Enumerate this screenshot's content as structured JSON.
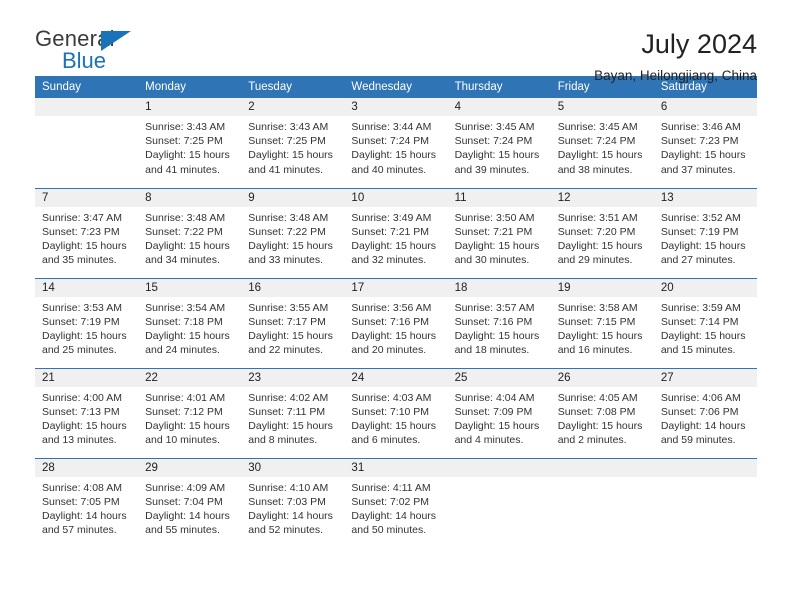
{
  "brand": {
    "name_top": "General",
    "name_bottom": "Blue"
  },
  "header": {
    "title": "July 2024",
    "subtitle": "Bayan, Heilongjiang, China"
  },
  "calendar": {
    "weekday_headers": [
      "Sunday",
      "Monday",
      "Tuesday",
      "Wednesday",
      "Thursday",
      "Friday",
      "Saturday"
    ],
    "accent_color": "#2f74b5",
    "daynum_background": "#f0f0f0",
    "weeks": [
      [
        {
          "day": "",
          "sunrise": "",
          "sunset": "",
          "daylight1": "",
          "daylight2": ""
        },
        {
          "day": "1",
          "sunrise": "Sunrise: 3:43 AM",
          "sunset": "Sunset: 7:25 PM",
          "daylight1": "Daylight: 15 hours",
          "daylight2": "and 41 minutes."
        },
        {
          "day": "2",
          "sunrise": "Sunrise: 3:43 AM",
          "sunset": "Sunset: 7:25 PM",
          "daylight1": "Daylight: 15 hours",
          "daylight2": "and 41 minutes."
        },
        {
          "day": "3",
          "sunrise": "Sunrise: 3:44 AM",
          "sunset": "Sunset: 7:24 PM",
          "daylight1": "Daylight: 15 hours",
          "daylight2": "and 40 minutes."
        },
        {
          "day": "4",
          "sunrise": "Sunrise: 3:45 AM",
          "sunset": "Sunset: 7:24 PM",
          "daylight1": "Daylight: 15 hours",
          "daylight2": "and 39 minutes."
        },
        {
          "day": "5",
          "sunrise": "Sunrise: 3:45 AM",
          "sunset": "Sunset: 7:24 PM",
          "daylight1": "Daylight: 15 hours",
          "daylight2": "and 38 minutes."
        },
        {
          "day": "6",
          "sunrise": "Sunrise: 3:46 AM",
          "sunset": "Sunset: 7:23 PM",
          "daylight1": "Daylight: 15 hours",
          "daylight2": "and 37 minutes."
        }
      ],
      [
        {
          "day": "7",
          "sunrise": "Sunrise: 3:47 AM",
          "sunset": "Sunset: 7:23 PM",
          "daylight1": "Daylight: 15 hours",
          "daylight2": "and 35 minutes."
        },
        {
          "day": "8",
          "sunrise": "Sunrise: 3:48 AM",
          "sunset": "Sunset: 7:22 PM",
          "daylight1": "Daylight: 15 hours",
          "daylight2": "and 34 minutes."
        },
        {
          "day": "9",
          "sunrise": "Sunrise: 3:48 AM",
          "sunset": "Sunset: 7:22 PM",
          "daylight1": "Daylight: 15 hours",
          "daylight2": "and 33 minutes."
        },
        {
          "day": "10",
          "sunrise": "Sunrise: 3:49 AM",
          "sunset": "Sunset: 7:21 PM",
          "daylight1": "Daylight: 15 hours",
          "daylight2": "and 32 minutes."
        },
        {
          "day": "11",
          "sunrise": "Sunrise: 3:50 AM",
          "sunset": "Sunset: 7:21 PM",
          "daylight1": "Daylight: 15 hours",
          "daylight2": "and 30 minutes."
        },
        {
          "day": "12",
          "sunrise": "Sunrise: 3:51 AM",
          "sunset": "Sunset: 7:20 PM",
          "daylight1": "Daylight: 15 hours",
          "daylight2": "and 29 minutes."
        },
        {
          "day": "13",
          "sunrise": "Sunrise: 3:52 AM",
          "sunset": "Sunset: 7:19 PM",
          "daylight1": "Daylight: 15 hours",
          "daylight2": "and 27 minutes."
        }
      ],
      [
        {
          "day": "14",
          "sunrise": "Sunrise: 3:53 AM",
          "sunset": "Sunset: 7:19 PM",
          "daylight1": "Daylight: 15 hours",
          "daylight2": "and 25 minutes."
        },
        {
          "day": "15",
          "sunrise": "Sunrise: 3:54 AM",
          "sunset": "Sunset: 7:18 PM",
          "daylight1": "Daylight: 15 hours",
          "daylight2": "and 24 minutes."
        },
        {
          "day": "16",
          "sunrise": "Sunrise: 3:55 AM",
          "sunset": "Sunset: 7:17 PM",
          "daylight1": "Daylight: 15 hours",
          "daylight2": "and 22 minutes."
        },
        {
          "day": "17",
          "sunrise": "Sunrise: 3:56 AM",
          "sunset": "Sunset: 7:16 PM",
          "daylight1": "Daylight: 15 hours",
          "daylight2": "and 20 minutes."
        },
        {
          "day": "18",
          "sunrise": "Sunrise: 3:57 AM",
          "sunset": "Sunset: 7:16 PM",
          "daylight1": "Daylight: 15 hours",
          "daylight2": "and 18 minutes."
        },
        {
          "day": "19",
          "sunrise": "Sunrise: 3:58 AM",
          "sunset": "Sunset: 7:15 PM",
          "daylight1": "Daylight: 15 hours",
          "daylight2": "and 16 minutes."
        },
        {
          "day": "20",
          "sunrise": "Sunrise: 3:59 AM",
          "sunset": "Sunset: 7:14 PM",
          "daylight1": "Daylight: 15 hours",
          "daylight2": "and 15 minutes."
        }
      ],
      [
        {
          "day": "21",
          "sunrise": "Sunrise: 4:00 AM",
          "sunset": "Sunset: 7:13 PM",
          "daylight1": "Daylight: 15 hours",
          "daylight2": "and 13 minutes."
        },
        {
          "day": "22",
          "sunrise": "Sunrise: 4:01 AM",
          "sunset": "Sunset: 7:12 PM",
          "daylight1": "Daylight: 15 hours",
          "daylight2": "and 10 minutes."
        },
        {
          "day": "23",
          "sunrise": "Sunrise: 4:02 AM",
          "sunset": "Sunset: 7:11 PM",
          "daylight1": "Daylight: 15 hours",
          "daylight2": "and 8 minutes."
        },
        {
          "day": "24",
          "sunrise": "Sunrise: 4:03 AM",
          "sunset": "Sunset: 7:10 PM",
          "daylight1": "Daylight: 15 hours",
          "daylight2": "and 6 minutes."
        },
        {
          "day": "25",
          "sunrise": "Sunrise: 4:04 AM",
          "sunset": "Sunset: 7:09 PM",
          "daylight1": "Daylight: 15 hours",
          "daylight2": "and 4 minutes."
        },
        {
          "day": "26",
          "sunrise": "Sunrise: 4:05 AM",
          "sunset": "Sunset: 7:08 PM",
          "daylight1": "Daylight: 15 hours",
          "daylight2": "and 2 minutes."
        },
        {
          "day": "27",
          "sunrise": "Sunrise: 4:06 AM",
          "sunset": "Sunset: 7:06 PM",
          "daylight1": "Daylight: 14 hours",
          "daylight2": "and 59 minutes."
        }
      ],
      [
        {
          "day": "28",
          "sunrise": "Sunrise: 4:08 AM",
          "sunset": "Sunset: 7:05 PM",
          "daylight1": "Daylight: 14 hours",
          "daylight2": "and 57 minutes."
        },
        {
          "day": "29",
          "sunrise": "Sunrise: 4:09 AM",
          "sunset": "Sunset: 7:04 PM",
          "daylight1": "Daylight: 14 hours",
          "daylight2": "and 55 minutes."
        },
        {
          "day": "30",
          "sunrise": "Sunrise: 4:10 AM",
          "sunset": "Sunset: 7:03 PM",
          "daylight1": "Daylight: 14 hours",
          "daylight2": "and 52 minutes."
        },
        {
          "day": "31",
          "sunrise": "Sunrise: 4:11 AM",
          "sunset": "Sunset: 7:02 PM",
          "daylight1": "Daylight: 14 hours",
          "daylight2": "and 50 minutes."
        },
        {
          "day": "",
          "sunrise": "",
          "sunset": "",
          "daylight1": "",
          "daylight2": ""
        },
        {
          "day": "",
          "sunrise": "",
          "sunset": "",
          "daylight1": "",
          "daylight2": ""
        },
        {
          "day": "",
          "sunrise": "",
          "sunset": "",
          "daylight1": "",
          "daylight2": ""
        }
      ]
    ]
  }
}
